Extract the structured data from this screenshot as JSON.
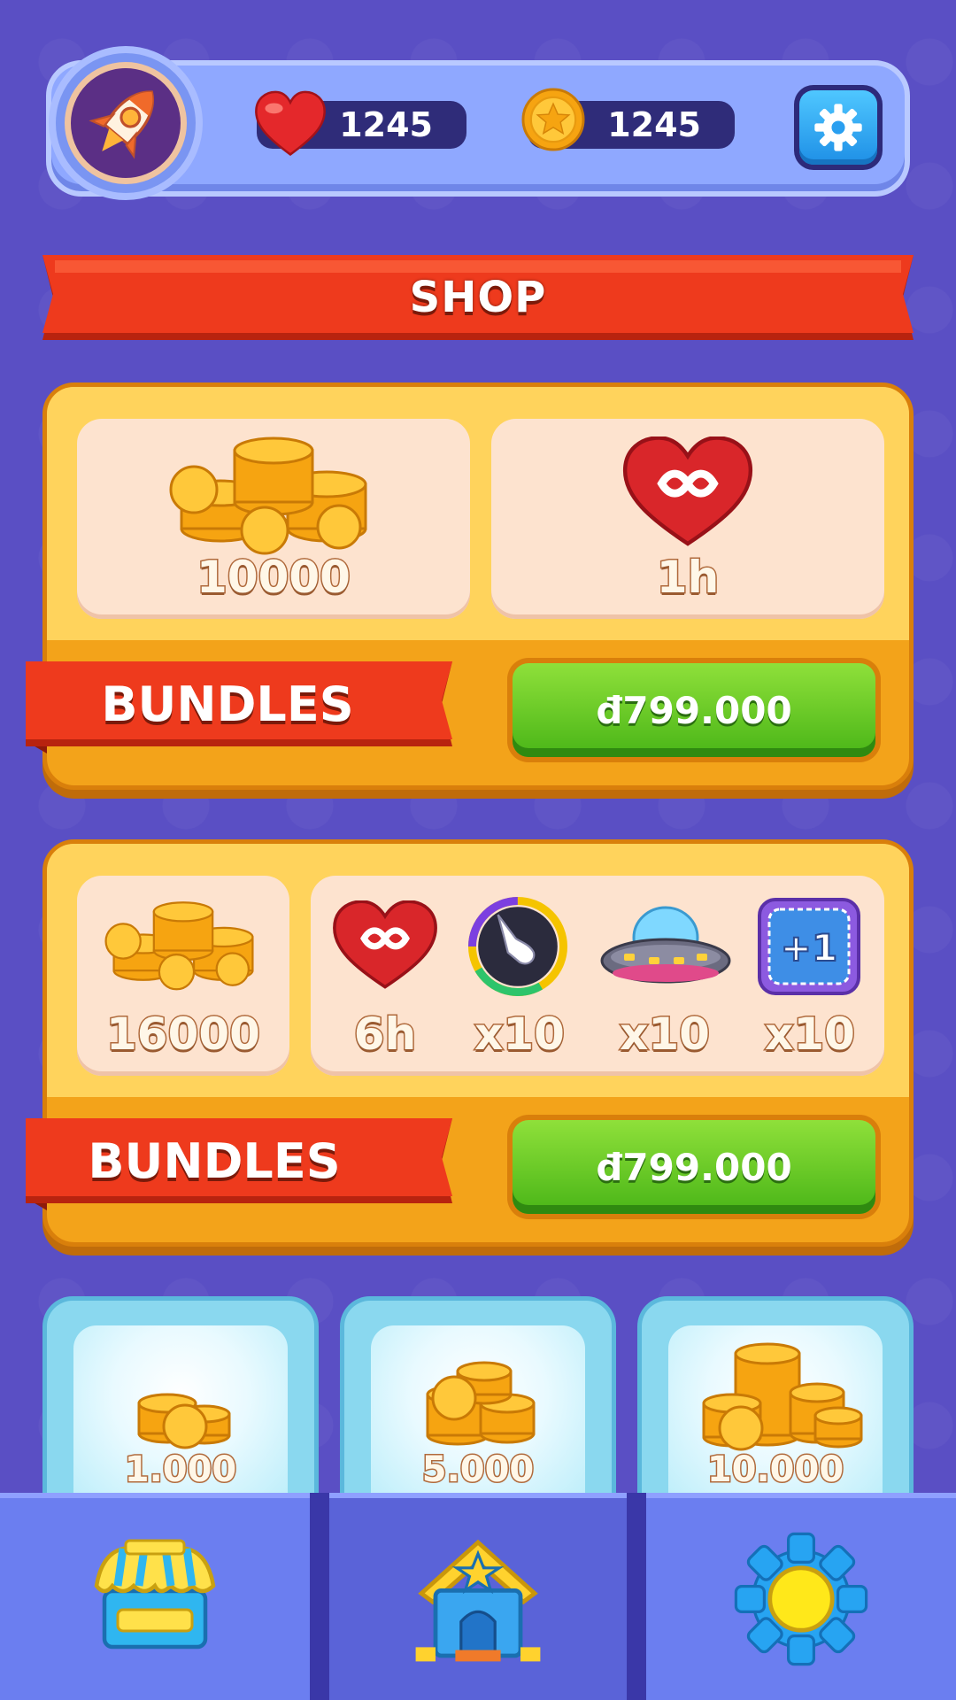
{
  "hud": {
    "avatar_icon": "rocket-icon",
    "hearts": "1245",
    "coins": "1245",
    "settings_icon": "gear-icon"
  },
  "shop": {
    "title": "SHOP"
  },
  "bundles": [
    {
      "ribbon": "BUNDLES",
      "price": "đ799.000",
      "items": [
        {
          "icon": "coin-pile-icon",
          "value": "10000"
        },
        {
          "icon": "infinite-heart-icon",
          "value": "1h"
        }
      ]
    },
    {
      "ribbon": "BUNDLES",
      "price": "đ799.000",
      "items": [
        {
          "icon": "coin-pile-icon",
          "value": "16000"
        },
        {
          "icon": "infinite-heart-icon",
          "value": "6h"
        },
        {
          "icon": "hand-booster-icon",
          "value": "x10"
        },
        {
          "icon": "ufo-booster-icon",
          "value": "x10"
        },
        {
          "icon": "plus-one-booster-icon",
          "value": "x10"
        }
      ]
    }
  ],
  "coin_packs": [
    {
      "amount": "1.000"
    },
    {
      "amount": "5.000"
    },
    {
      "amount": "10.000"
    }
  ],
  "nav": [
    {
      "icon": "shop-icon"
    },
    {
      "icon": "home-icon"
    },
    {
      "icon": "settings-icon"
    }
  ],
  "colors": {
    "background": "#5a4fc4",
    "banner_red": "#e8391c",
    "bundle_orange": "#f3a31a",
    "buy_green": "#49b517"
  }
}
